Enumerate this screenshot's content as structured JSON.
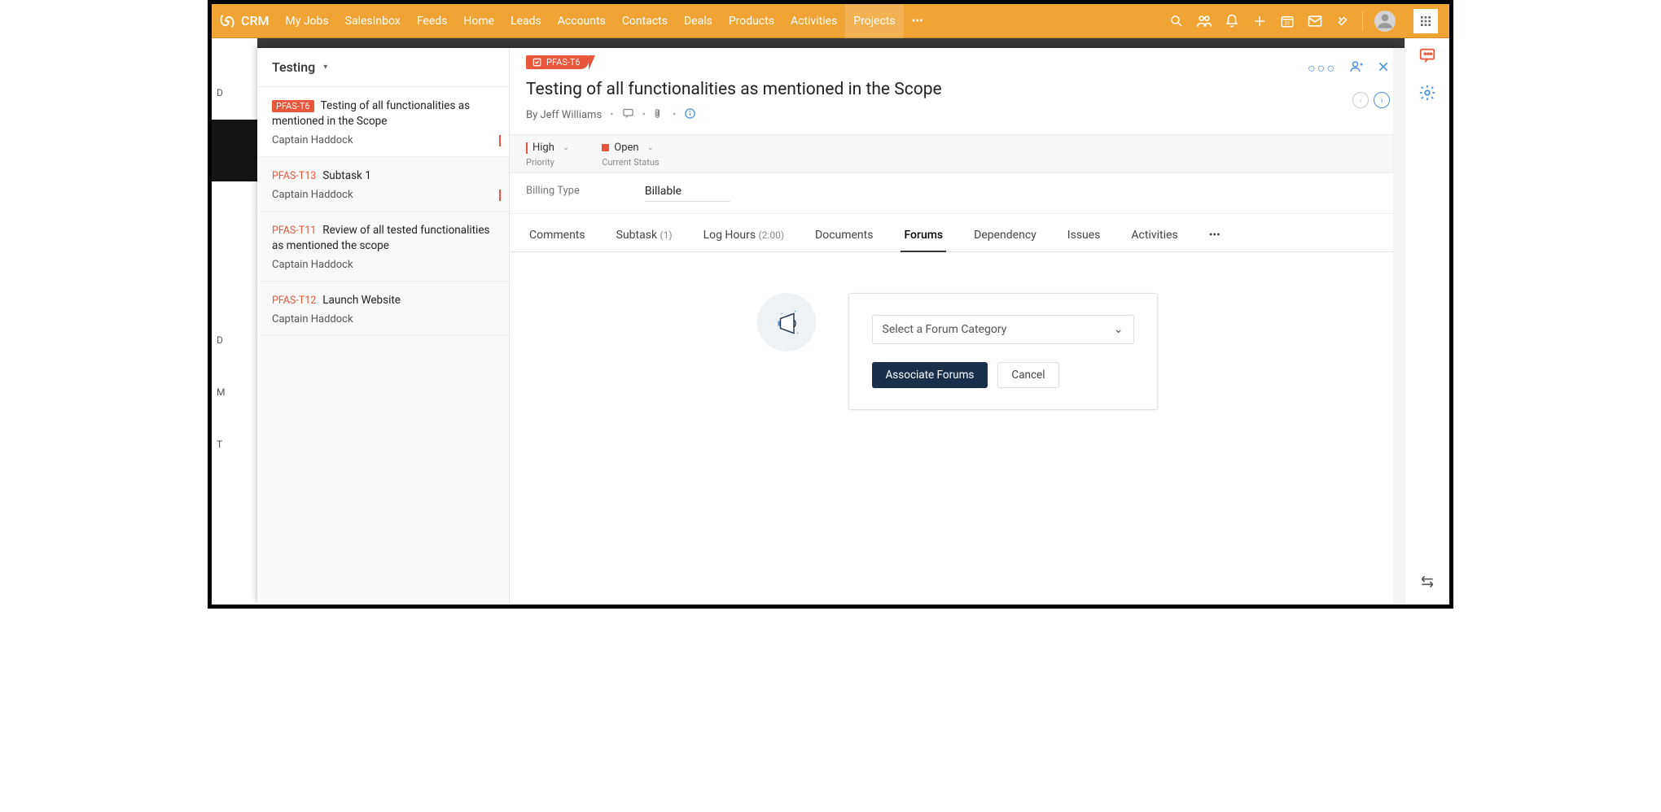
{
  "app": {
    "name": "CRM"
  },
  "nav": {
    "items": [
      "My Jobs",
      "SalesInbox",
      "Feeds",
      "Home",
      "Leads",
      "Accounts",
      "Contacts",
      "Deals",
      "Products",
      "Activities",
      "Projects"
    ],
    "active": "Projects"
  },
  "sidebar": {
    "title": "Testing",
    "tasks": [
      {
        "id": "PFAS-T6",
        "title": "Testing of all functionalities as mentioned in the Scope",
        "owner": "Captain Haddock",
        "badge": true,
        "mark": true,
        "selected": true
      },
      {
        "id": "PFAS-T13",
        "title": "Subtask 1",
        "owner": "Captain Haddock",
        "badge": false,
        "mark": true,
        "selected": false
      },
      {
        "id": "PFAS-T11",
        "title": "Review of all tested functionalities as mentioned the scope",
        "owner": "Captain Haddock",
        "badge": false,
        "mark": false,
        "selected": false
      },
      {
        "id": "PFAS-T12",
        "title": "Launch Website",
        "owner": "Captain Haddock",
        "badge": false,
        "mark": false,
        "selected": false
      }
    ]
  },
  "detail": {
    "chip": "PFAS-T6",
    "title": "Testing of all functionalities as mentioned in the Scope",
    "byline": "By Jeff Williams",
    "priority": {
      "value": "High",
      "label": "Priority"
    },
    "status": {
      "value": "Open",
      "label": "Current Status"
    },
    "billing": {
      "label": "Billing Type",
      "value": "Billable"
    }
  },
  "tabs": {
    "items": [
      {
        "label": "Comments",
        "count": ""
      },
      {
        "label": "Subtask",
        "count": "(1)"
      },
      {
        "label": "Log Hours",
        "count": "(2:00)"
      },
      {
        "label": "Documents",
        "count": ""
      },
      {
        "label": "Forums",
        "count": ""
      },
      {
        "label": "Dependency",
        "count": ""
      },
      {
        "label": "Issues",
        "count": ""
      },
      {
        "label": "Activities",
        "count": ""
      }
    ],
    "active": "Forums"
  },
  "forum": {
    "select_placeholder": "Select a Forum Category",
    "associate": "Associate Forums",
    "cancel": "Cancel"
  },
  "gutter": {
    "d1": "D",
    "d2": "D",
    "m": "M",
    "t": "T"
  }
}
